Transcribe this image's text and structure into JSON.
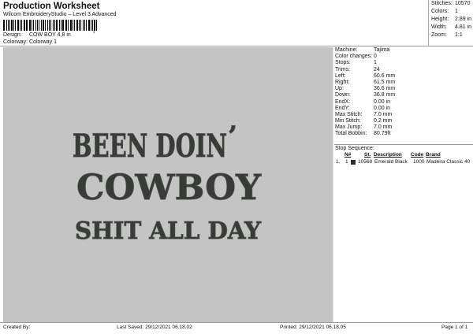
{
  "header": {
    "title": "Production Worksheet",
    "software": "Wilcom EmbroideryStudio – Level 3 Advanced",
    "design_label": "Design:",
    "design_value": "COW BOY  4,8 in",
    "colorway_label": "Colorway:",
    "colorway_value": "Colorway 1"
  },
  "stats": [
    {
      "label": "Stitches:",
      "value": "10570"
    },
    {
      "label": "Colors:",
      "value": "1"
    },
    {
      "label": "Height:",
      "value": "2.89 in"
    },
    {
      "label": "Width:",
      "value": "4.81 in"
    },
    {
      "label": "Zoom:",
      "value": "1:1"
    }
  ],
  "design_text": {
    "line1": "BEEN DOIN",
    "line1_apostrophe": "’",
    "line2": "COWBOY",
    "line3": "SHIT ALL DAY",
    "thread_color": "#383b37",
    "outline_color": "#6d726b",
    "background_color": "#c4c4c4"
  },
  "properties": [
    {
      "label": "Machine:",
      "value": "Tajima"
    },
    {
      "label": "Color changes:",
      "value": "0"
    },
    {
      "label": "Stops:",
      "value": "1"
    },
    {
      "label": "Trims:",
      "value": "24"
    },
    {
      "label": "Left:",
      "value": "60.6 mm"
    },
    {
      "label": "Right:",
      "value": "61.5 mm"
    },
    {
      "label": "Up:",
      "value": "36.6 mm"
    },
    {
      "label": "Down:",
      "value": "36.8 mm"
    },
    {
      "label": "EndX:",
      "value": "0.00 in"
    },
    {
      "label": "EndY:",
      "value": "0.00 in"
    },
    {
      "label": "Max Stitch:",
      "value": "7.0 mm"
    },
    {
      "label": "Min Stitch:",
      "value": "0.2 mm"
    },
    {
      "label": "Max Jump:",
      "value": "7.0 mm"
    },
    {
      "label": "Total Bobbin:",
      "value": "80.79ft"
    }
  ],
  "stop_sequence": {
    "title": "Stop Sequence:",
    "headers": {
      "n": "N#",
      "st": "St.",
      "description": "Description",
      "code": "Code",
      "brand": "Brand"
    },
    "rows": [
      {
        "index": "1.",
        "n": "1",
        "swatch_color": "#2b2d2a",
        "st": "10568",
        "description": "Emerald Black",
        "code": "1000",
        "brand": "Madeira Classic 40"
      }
    ]
  },
  "footer": {
    "created_by": "Created By:",
    "last_saved": "Last Saved: 29/12/2021 06.18.02",
    "printed": "Printed: 29/12/2021 06.18.05",
    "page": "Page 1 of 1"
  }
}
